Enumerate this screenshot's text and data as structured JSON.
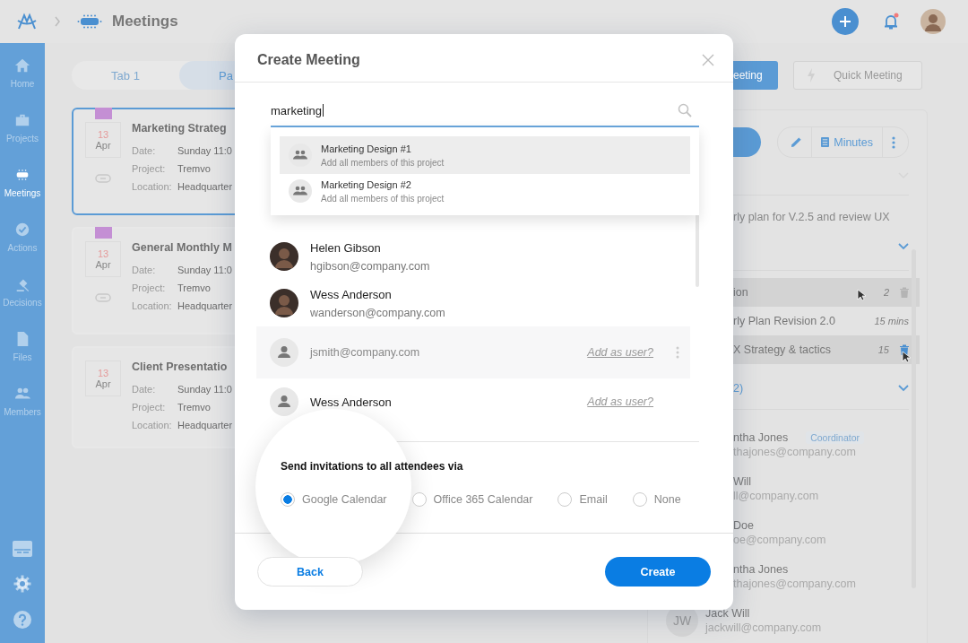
{
  "header": {
    "title": "Meetings",
    "notification": true
  },
  "sidebar": {
    "items": [
      {
        "label": "Home",
        "selected": false
      },
      {
        "label": "Projects",
        "selected": false
      },
      {
        "label": "Meetings",
        "selected": true
      },
      {
        "label": "Actions",
        "selected": false
      },
      {
        "label": "Decisions",
        "selected": false
      },
      {
        "label": "Files",
        "selected": false
      },
      {
        "label": "Members",
        "selected": false
      }
    ]
  },
  "tabs": [
    {
      "label": "Tab 1",
      "selected": false
    },
    {
      "label": "Pa",
      "selected": true
    }
  ],
  "meetings": [
    {
      "title": "Marketing Strateg",
      "day": "13",
      "month": "Apr",
      "color": "#c48fd4",
      "selected": true,
      "fields": [
        {
          "label": "Date:",
          "value": "Sunday 11:0"
        },
        {
          "label": "Project:",
          "value": "Tremvo"
        },
        {
          "label": "Location:",
          "value": "Headquarter"
        }
      ]
    },
    {
      "title": "General Monthly M",
      "day": "13",
      "month": "Apr",
      "color": "#c48fd4",
      "selected": false,
      "fields": [
        {
          "label": "Date:",
          "value": "Sunday 11:0"
        },
        {
          "label": "Project:",
          "value": "Tremvo"
        },
        {
          "label": "Location:",
          "value": "Headquarter"
        }
      ]
    },
    {
      "title": "Client Presentatio",
      "day": "13",
      "month": "Apr",
      "selected": false,
      "fields": [
        {
          "label": "Date:",
          "value": "Sunday 11:0"
        },
        {
          "label": "Project:",
          "value": "Tremvo"
        },
        {
          "label": "Location:",
          "value": "Headquarter"
        }
      ]
    }
  ],
  "right_panel": {
    "buttons": [
      {
        "label": "eeting",
        "kind": "primary"
      },
      {
        "label": "Quick Meeting",
        "kind": "outline"
      }
    ],
    "minutes_label": "Minutes",
    "description": "rly plan for V.2.5 and review UX",
    "agenda": [
      {
        "title": "ion",
        "duration": "2",
        "kind": "deletable",
        "highlighted": true,
        "cursor": true,
        "trash_hover": false
      },
      {
        "title": "rly Plan Revision 2.0",
        "duration": "15 mins",
        "kind": "timed",
        "highlighted": false,
        "cursor": false
      },
      {
        "title": "X Strategy & tactics",
        "duration": "15",
        "kind": "deletable",
        "highlighted": true,
        "cursor": true,
        "trash_hover": true
      }
    ],
    "attendees_heading": "2)",
    "attendees": [
      {
        "name": "ntha Jones",
        "email": "thajones@company.com",
        "role": "Coordinator"
      },
      {
        "name": "Will",
        "email": "ll@company.com"
      },
      {
        "name": "Doe",
        "email": "oe@company.com"
      },
      {
        "name": "ntha Jones",
        "email": "thajones@company.com"
      },
      {
        "name": "Jack Will",
        "email": "jackwill@company.com",
        "initials": "JW"
      }
    ]
  },
  "modal": {
    "title": "Create Meeting",
    "search": {
      "value": "marketing"
    },
    "suggestions": [
      {
        "title": "Marketing Design #1",
        "subtitle": "Add all members of this project",
        "selected": true
      },
      {
        "title": "Marketing Design #2",
        "subtitle": "Add all members of this project",
        "selected": false
      }
    ],
    "people": [
      {
        "name": "Helen Gibson",
        "email": "hgibson@company.com",
        "kind": "photo",
        "highlighted": false,
        "menu": false
      },
      {
        "name": "Wess Anderson",
        "email": "wanderson@company.com",
        "kind": "photo",
        "highlighted": false,
        "menu": false
      },
      {
        "email": "jsmith@company.com",
        "kind": "generic",
        "action": "Add as user?",
        "highlighted": true,
        "menu": true
      },
      {
        "name": "Wess Anderson",
        "kind": "generic",
        "action": "Add as user?",
        "highlighted": false,
        "menu": false
      }
    ],
    "invite": {
      "label": "Send invitations to all attendees via",
      "options": [
        {
          "label": "Google Calendar",
          "selected": true
        },
        {
          "label": "Office 365 Calendar",
          "selected": false
        },
        {
          "label": "Email",
          "selected": false
        },
        {
          "label": "None",
          "selected": false
        }
      ]
    },
    "back_label": "Back",
    "create_label": "Create"
  }
}
